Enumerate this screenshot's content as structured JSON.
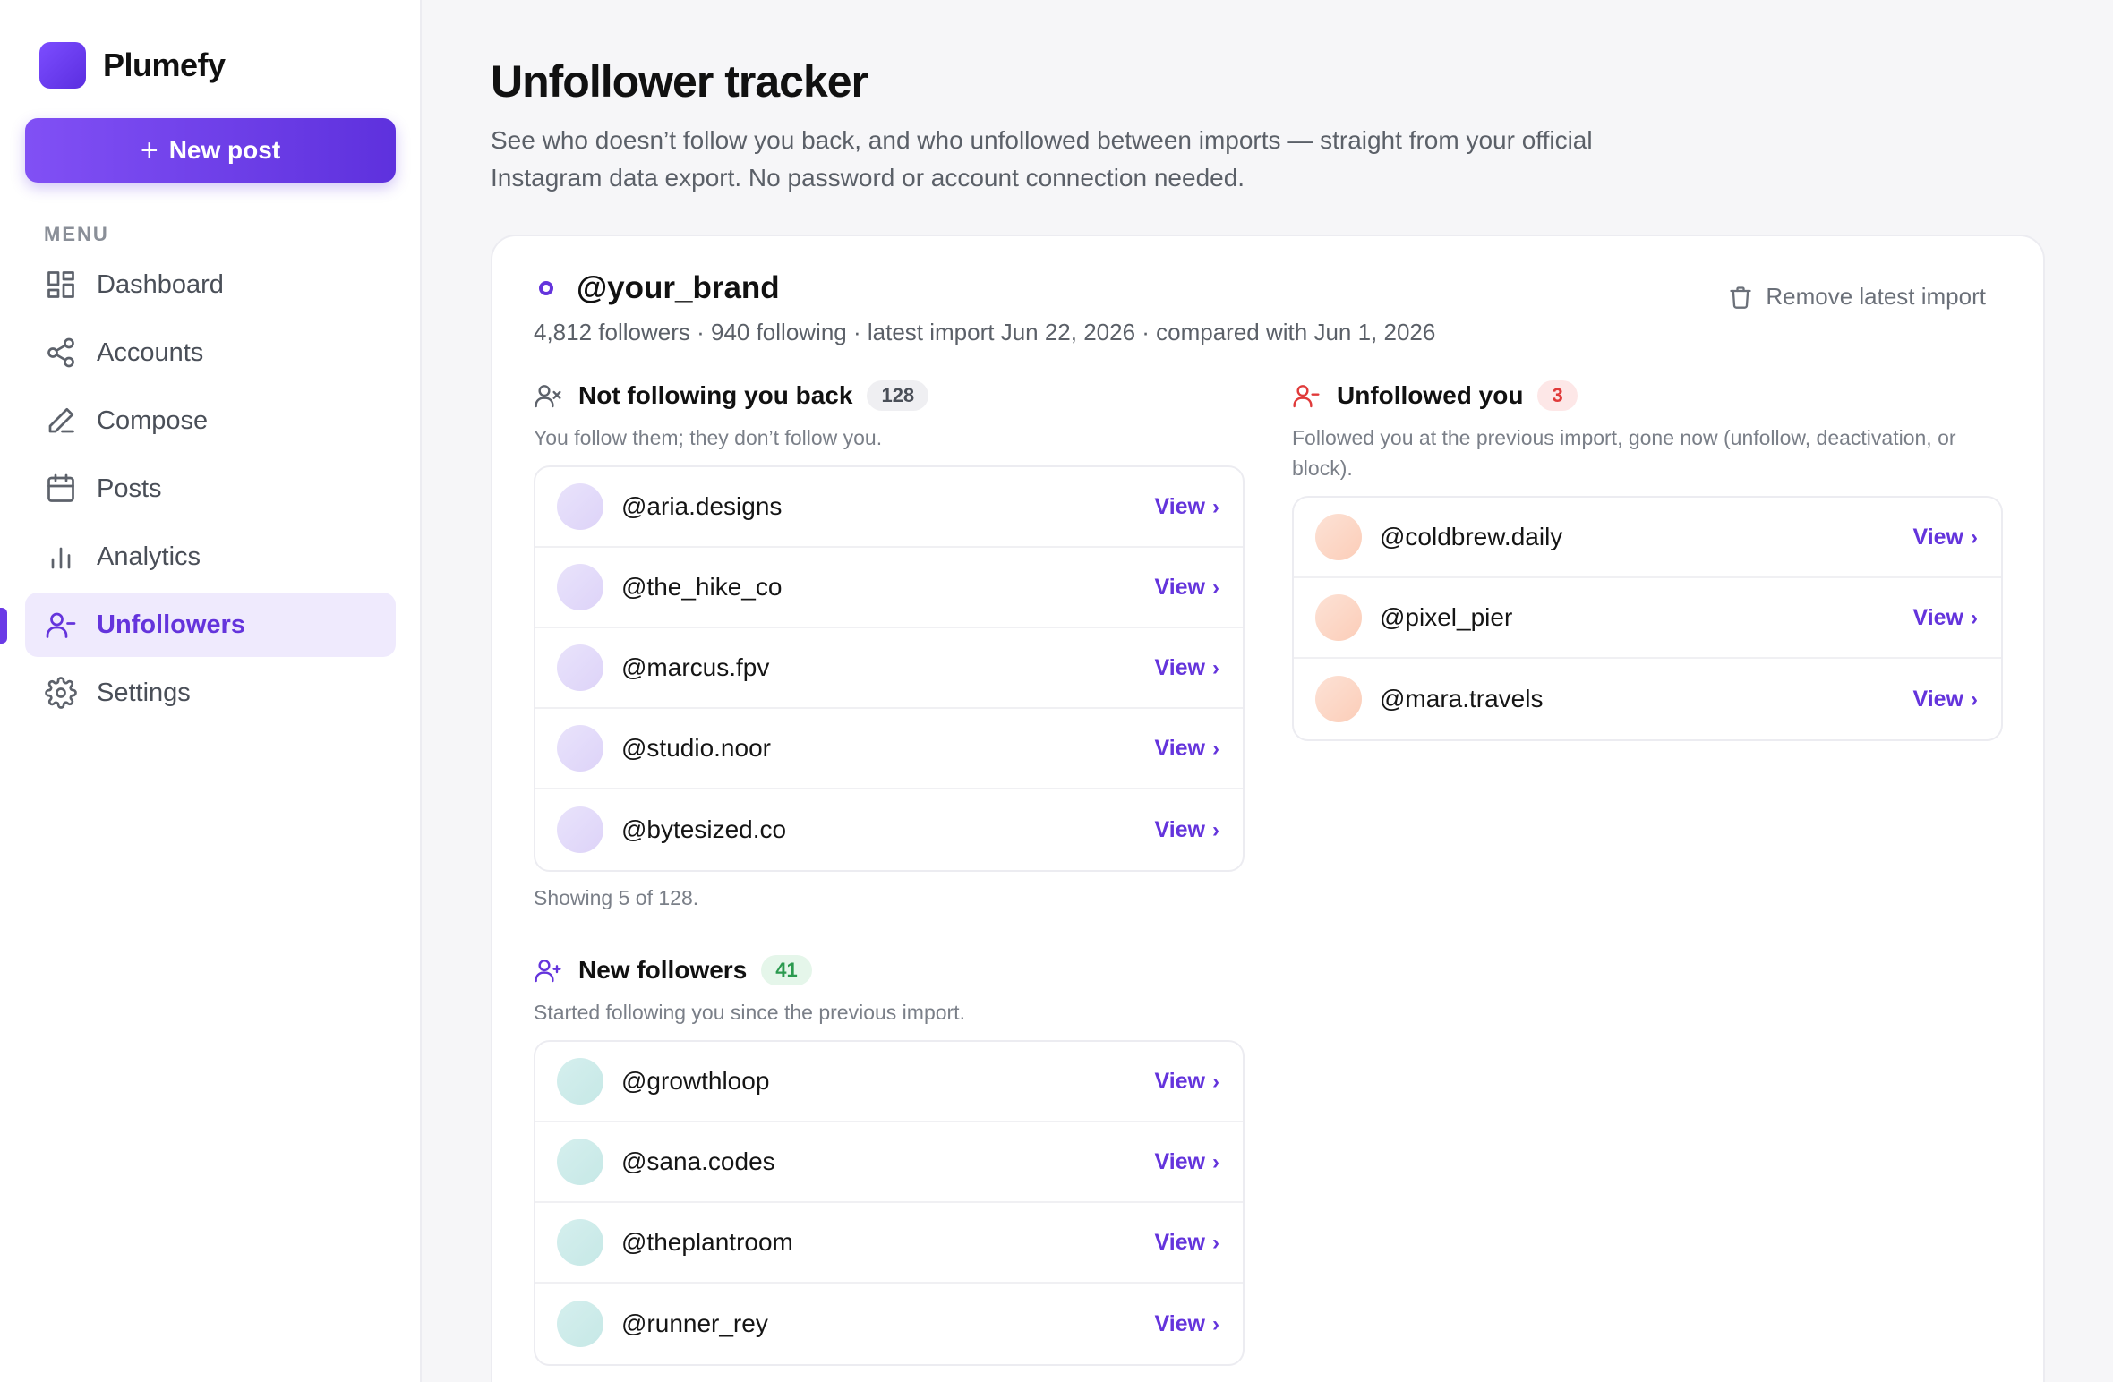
{
  "app": {
    "name": "Plumefy"
  },
  "sidebar": {
    "new_post_label": "New post",
    "menu_label": "MENU",
    "items": [
      {
        "label": "Dashboard",
        "icon": "dashboard-icon"
      },
      {
        "label": "Accounts",
        "icon": "share-icon"
      },
      {
        "label": "Compose",
        "icon": "pen-icon"
      },
      {
        "label": "Posts",
        "icon": "calendar-icon"
      },
      {
        "label": "Analytics",
        "icon": "bar-chart-icon"
      },
      {
        "label": "Unfollowers",
        "icon": "user-minus-icon",
        "active": true
      },
      {
        "label": "Settings",
        "icon": "gear-icon"
      }
    ]
  },
  "page": {
    "title": "Unfollower tracker",
    "description": "See who doesn’t follow you back, and who unfollowed between imports — straight from your official Instagram data export. No password or account connection needed."
  },
  "account": {
    "handle": "@your_brand",
    "meta": "4,812 followers · 940 following · latest import Jun 22, 2026 · compared with Jun 1, 2026",
    "remove_label": "Remove latest import"
  },
  "not_following_back": {
    "title": "Not following you back",
    "count": "128",
    "description": "You follow them; they don’t follow you.",
    "items": [
      "@aria.designs",
      "@the_hike_co",
      "@marcus.fpv",
      "@studio.noor",
      "@bytesized.co"
    ],
    "footer": "Showing 5 of 128."
  },
  "unfollowed_you": {
    "title": "Unfollowed you",
    "count": "3",
    "description": "Followed you at the previous import, gone now (unfollow, deactivation, or block).",
    "items": [
      "@coldbrew.daily",
      "@pixel_pier",
      "@mara.travels"
    ]
  },
  "new_followers": {
    "title": "New followers",
    "count": "41",
    "description": "Started following you since the previous import.",
    "items": [
      "@growthloop",
      "@sana.codes",
      "@theplantroom",
      "@runner_rey"
    ]
  },
  "view_label": "View",
  "colors": {
    "accent": "#6434dc",
    "danger": "#e03a3a",
    "success": "#2b9a4f"
  }
}
